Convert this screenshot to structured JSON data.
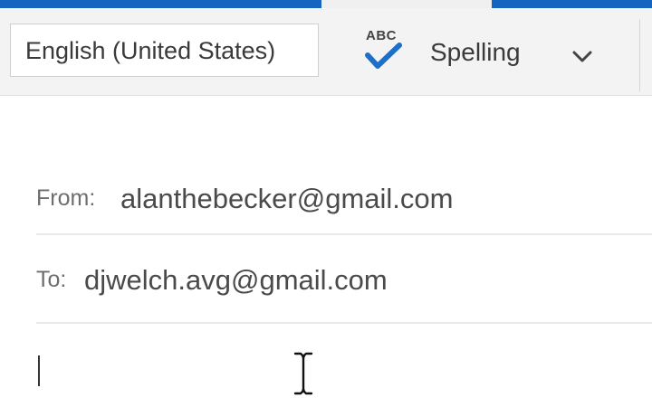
{
  "ribbon": {
    "language_value": "English (United States)",
    "spelling": {
      "icon_text": "ABC",
      "icon": "check-icon",
      "label": "Spelling"
    },
    "dropdown_icon": "chevron-down-icon"
  },
  "message": {
    "from_label": "From:",
    "from_value": "alanthebecker@gmail.com",
    "to_label": "To:",
    "to_value": "djwelch.avg@gmail.com",
    "body_text": ""
  },
  "colors": {
    "accent": "#1565c0",
    "ribbon_bg": "#f3f3f3",
    "check_blue": "#1e6fc7"
  }
}
